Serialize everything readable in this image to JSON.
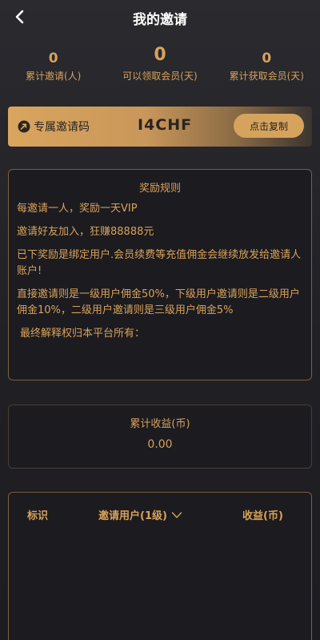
{
  "header": {
    "title": "我的邀请"
  },
  "stats": [
    {
      "value": "0",
      "label": "累计邀请(人)"
    },
    {
      "value": "0",
      "label": "可以领取会员(天)"
    },
    {
      "value": "0",
      "label": "累计获取会员(天)"
    }
  ],
  "invite": {
    "label": "专属邀请码",
    "code": "I4CHF",
    "copy_label": "点击复制"
  },
  "rules": {
    "title": "奖励规则",
    "items": [
      "每邀请一人，奖励一天VIP",
      "邀请好友加入，狂赚88888元",
      "已下奖励是绑定用户.会员续费等充值佣金会继续放发给邀请人账户!",
      "直接邀请则是一级用户佣金50%，下级用户邀请则是二级用户佣金10%，二级用户邀请则是三级用户佣金5%",
      "最终解释权归本平台所有："
    ]
  },
  "earnings": {
    "label": "累计收益(币)",
    "value": "0.00"
  },
  "table": {
    "columns": [
      "标识",
      "邀请用户(1级)",
      "收益(币)"
    ]
  },
  "colors": {
    "accent": "#d8a25a",
    "background": "#1f1f24",
    "invite_bar_start": "#d9a55e"
  }
}
